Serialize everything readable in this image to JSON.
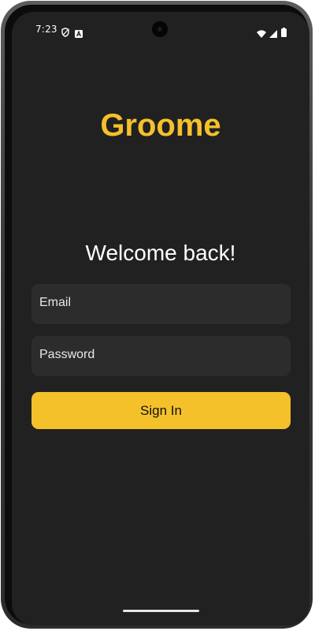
{
  "status_bar": {
    "time": "7:23",
    "icons": [
      "shield-icon",
      "a-box-icon",
      "wifi-icon",
      "signal-icon",
      "battery-icon"
    ]
  },
  "app": {
    "name": "Groome",
    "accent_color": "#f4c12b",
    "background_color": "#212121"
  },
  "login": {
    "heading": "Welcome back!",
    "email_placeholder": "Email",
    "email_value": "",
    "password_placeholder": "Password",
    "password_value": "",
    "signin_label": "Sign In"
  }
}
